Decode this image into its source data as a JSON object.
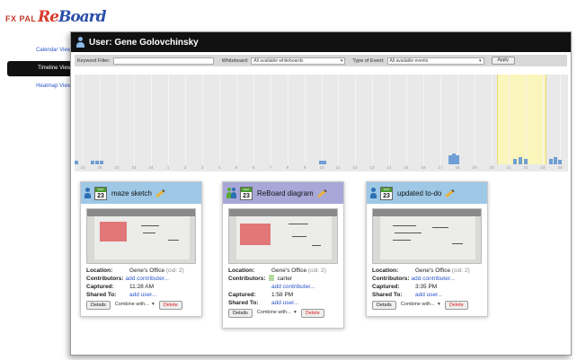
{
  "logo": {
    "fx_text": "FX PAL",
    "re_text": "Re",
    "board_text": "Board"
  },
  "nav": {
    "items": [
      {
        "label": "Calendar View",
        "active": false
      },
      {
        "label": "Timeline View",
        "active": true
      },
      {
        "label": "Heatmap View",
        "active": false
      }
    ]
  },
  "header": {
    "title": "User: Gene Golovchinsky"
  },
  "filters": {
    "keyword_label": "Keyword Filter:",
    "keyword_value": "",
    "whiteboard_label": "Whiteboard:",
    "whiteboard_value": "All available whiteboards",
    "event_label": "Type of Event:",
    "event_value": "All available events",
    "apply_label": "Apply"
  },
  "timeline": {
    "ticks": [
      "18",
      "20",
      "22",
      "23",
      "24",
      "1",
      "2",
      "3",
      "4",
      "5",
      "6",
      "7",
      "8",
      "9",
      "10",
      "11",
      "12",
      "13",
      "14",
      "15",
      "16",
      "17",
      "18",
      "19",
      "20",
      "21",
      "22",
      "23",
      "24"
    ],
    "colors": {
      "bar": "#6f9fd4",
      "highlight": "#fff8aa"
    }
  },
  "cards": [
    {
      "title": "maze sketch",
      "month": "MAR",
      "day": "23",
      "group": false,
      "location_label": "Location:",
      "location": "Gene's Office",
      "location_id": "(cid: 2)",
      "contributors_label": "Contributors:",
      "contributors": [],
      "add_contributor": "add contributer...",
      "captured_label": "Captured:",
      "captured": "11:28 AM",
      "shared_label": "Shared To:",
      "add_user": "add user...",
      "details_label": "Details",
      "combine_label": "Combine with...",
      "delete_label": "Delete"
    },
    {
      "title": "ReBoard diagram",
      "month": "MAR",
      "day": "23",
      "group": true,
      "location_label": "Location:",
      "location": "Gene's Office",
      "location_id": "(cid: 2)",
      "contributors_label": "Contributors:",
      "contributors": [
        "carter"
      ],
      "add_contributor": "add contributer...",
      "captured_label": "Captured:",
      "captured": "1:58 PM",
      "shared_label": "Shared To:",
      "add_user": "add user...",
      "details_label": "Details",
      "combine_label": "Combine with...",
      "delete_label": "Delete"
    },
    {
      "title": "updated to-do",
      "month": "MAR",
      "day": "23",
      "group": false,
      "location_label": "Location:",
      "location": "Gene's Office",
      "location_id": "(cid: 2)",
      "contributors_label": "Contributors:",
      "contributors": [],
      "add_contributor": "add contributer...",
      "captured_label": "Captured:",
      "captured": "3:35 PM",
      "shared_label": "Shared To:",
      "add_user": "add user...",
      "details_label": "Details",
      "combine_label": "Combine with...",
      "delete_label": "Delete"
    }
  ]
}
